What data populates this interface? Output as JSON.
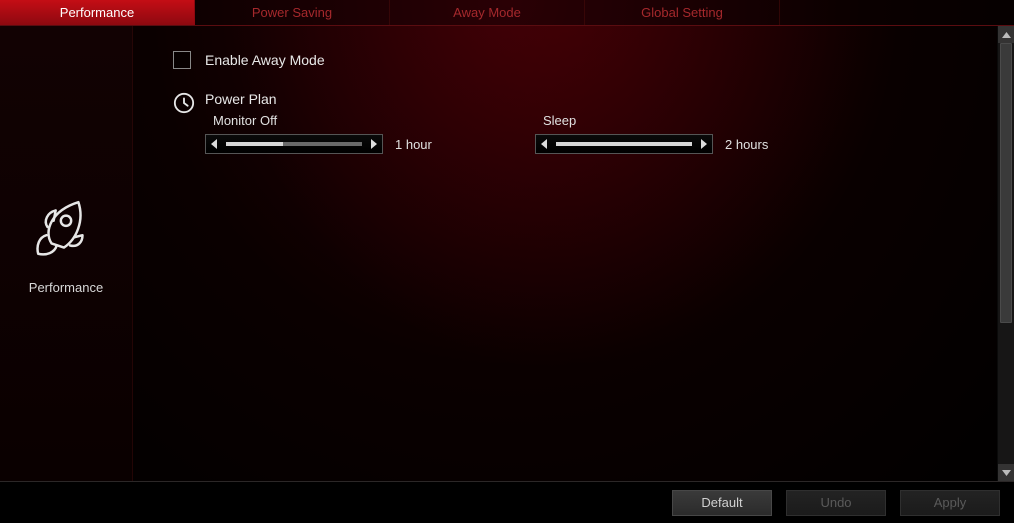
{
  "tabs": [
    {
      "label": "Performance",
      "active": true
    },
    {
      "label": "Power Saving",
      "active": false
    },
    {
      "label": "Away Mode",
      "active": false
    },
    {
      "label": "Global Setting",
      "active": false
    }
  ],
  "sidebar": {
    "label": "Performance"
  },
  "away_mode": {
    "checkbox_label": "Enable Away Mode",
    "checked": false
  },
  "power_plan": {
    "title": "Power Plan",
    "monitor_off": {
      "label": "Monitor Off",
      "value_label": "1 hour",
      "fill_pct": 42
    },
    "sleep": {
      "label": "Sleep",
      "value_label": "2 hours",
      "fill_pct": 100
    }
  },
  "footer": {
    "default": "Default",
    "undo": "Undo",
    "apply": "Apply"
  }
}
